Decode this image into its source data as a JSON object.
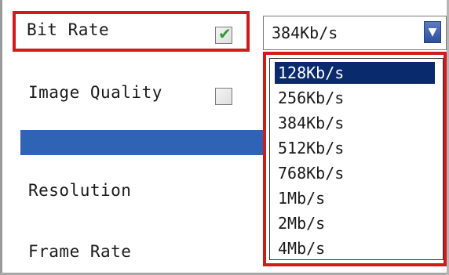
{
  "form": {
    "bit_rate_label": "Bit Rate",
    "bit_rate_checked": true,
    "image_quality_label": "Image Quality",
    "image_quality_checked": false,
    "resolution_label": "Resolution",
    "frame_rate_label": "Frame Rate"
  },
  "select": {
    "value": "384Kb/s",
    "arrow_icon": "triangle-down-icon",
    "options": [
      "128Kb/s",
      "256Kb/s",
      "384Kb/s",
      "512Kb/s",
      "768Kb/s",
      "1Mb/s",
      "2Mb/s",
      "4Mb/s"
    ],
    "highlighted_option": "128Kb/s"
  },
  "colors": {
    "highlight_border": "#d11b1b",
    "selected_option_bg": "#0a2a6e",
    "section_bar": "#2f63b5",
    "checkmark": "#2e9b2e"
  }
}
